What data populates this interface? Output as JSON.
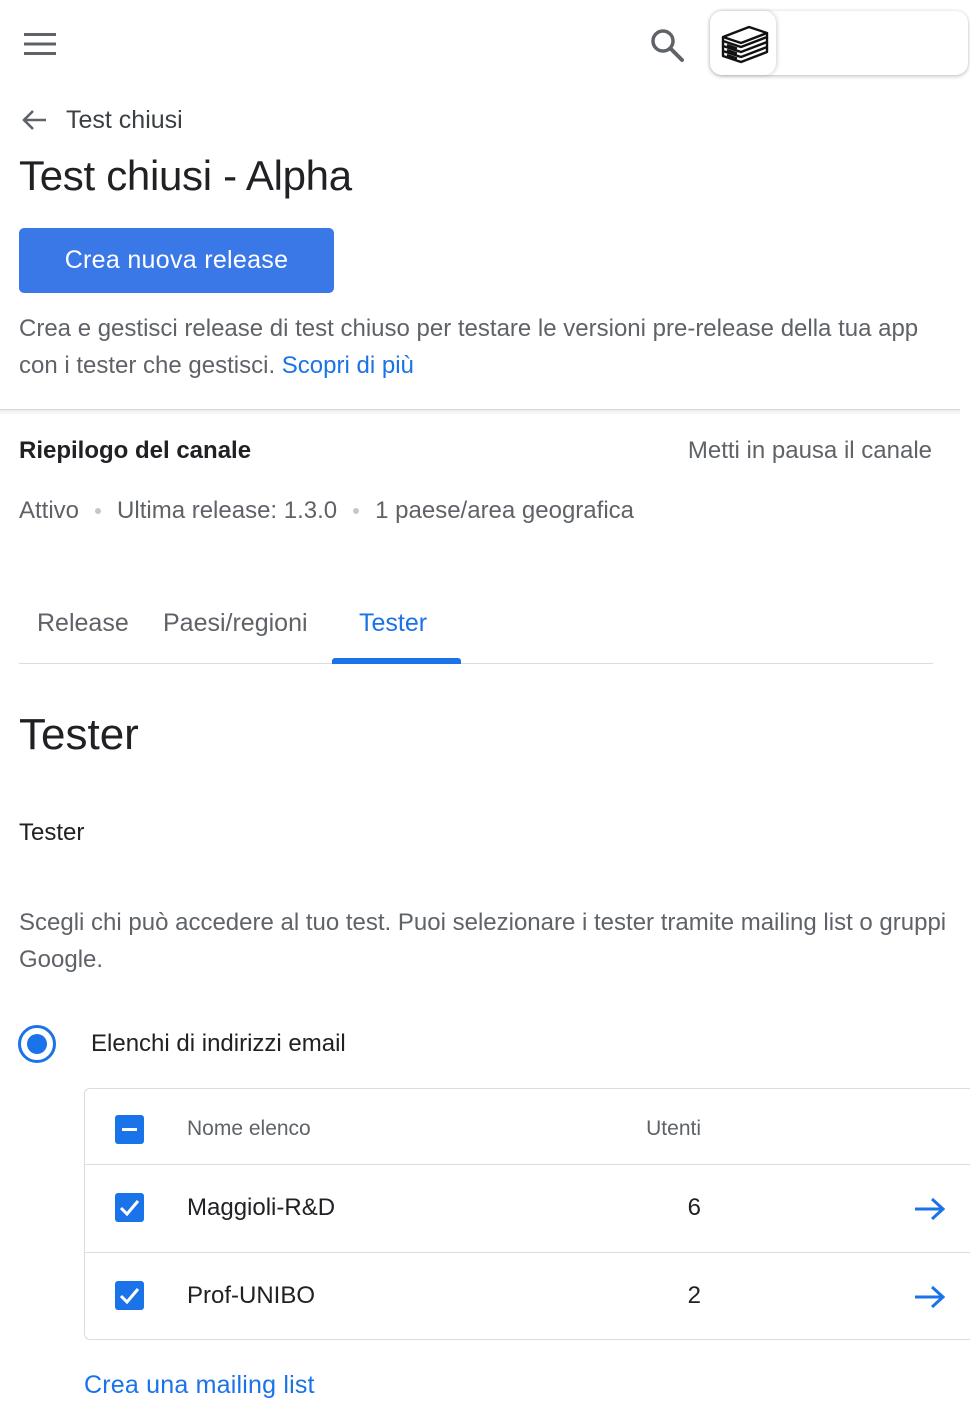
{
  "topbar": {
    "menu_icon": "hamburger-menu-icon",
    "search_icon": "search-icon",
    "app_logo_icon": "books-stack-icon"
  },
  "breadcrumb": {
    "back_label": "Test chiusi"
  },
  "page": {
    "title": "Test chiusi - Alpha",
    "primary_button": "Crea nuova release",
    "description": "Crea e gestisci release di test chiuso per testare le versioni pre-release della tua app con i tester che gestisci.",
    "learn_more": "Scopri di più"
  },
  "channel": {
    "title": "Riepilogo del canale",
    "pause_link": "Metti in pausa il canale",
    "status": "Attivo",
    "last_release": "Ultima release: 1.3.0",
    "countries": "1 paese/area geografica"
  },
  "tabs": [
    {
      "label": "Release",
      "active": false
    },
    {
      "label": "Paesi/regioni",
      "active": false
    },
    {
      "label": "Tester",
      "active": true
    }
  ],
  "tester_section": {
    "heading": "Tester",
    "sub_label": "Tester",
    "description": "Scegli chi può accedere al tuo test. Puoi selezionare i tester tramite mailing list o gruppi Google.",
    "radio_label": "Elenchi di indirizzi email",
    "radio_selected": true
  },
  "email_lists": {
    "columns": {
      "name": "Nome elenco",
      "users": "Utenti"
    },
    "header_checkbox": "indeterminate",
    "rows": [
      {
        "name": "Maggioli-R&D",
        "users": "6",
        "checked": true
      },
      {
        "name": "Prof-UNIBO",
        "users": "2",
        "checked": true
      }
    ],
    "create_link": "Crea una mailing list"
  },
  "colors": {
    "accent": "#1a73e8",
    "primary_button": "#3b78e7",
    "text_primary": "#202124",
    "text_secondary": "#5f6368"
  }
}
